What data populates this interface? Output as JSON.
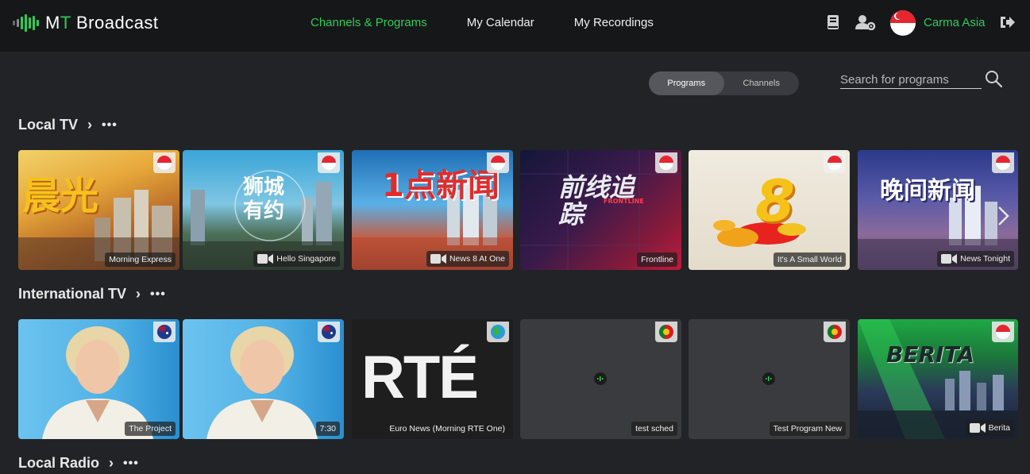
{
  "app": {
    "logo_m": "M",
    "logo_t": "T",
    "logo_rest": " Broadcast"
  },
  "nav": [
    {
      "label": "Channels & Programs",
      "active": true
    },
    {
      "label": "My Calendar",
      "active": false
    },
    {
      "label": "My Recordings",
      "active": false
    }
  ],
  "header_icons": [
    "book-icon",
    "user-settings-icon",
    "logout-icon"
  ],
  "user": {
    "name": "Carma Asia"
  },
  "toggle": {
    "programs": "Programs",
    "channels": "Channels",
    "selected": "Programs"
  },
  "search": {
    "placeholder": "Search for programs",
    "value": ""
  },
  "sections": [
    {
      "title": "Local TV",
      "cards": [
        {
          "label": "Morning Express",
          "flag": "singapore",
          "camera": false
        },
        {
          "label": "Hello Singapore",
          "flag": "singapore",
          "camera": true
        },
        {
          "label": "News 8 At One",
          "flag": "singapore",
          "camera": true
        },
        {
          "label": "Frontline",
          "flag": "singapore",
          "camera": false
        },
        {
          "label": "It's A Small World",
          "flag": "singapore",
          "camera": false
        },
        {
          "label": "News Tonight",
          "flag": "singapore",
          "camera": true
        }
      ],
      "thumb_texts": [
        "晨光",
        "狮城有约",
        "1点新闻",
        "前线追踪",
        "8",
        "晚间新闻"
      ],
      "thumb_sub_texts": [
        "FRONTLINE"
      ]
    },
    {
      "title": "International TV",
      "cards": [
        {
          "label": "The Project",
          "flag": "australia",
          "camera": false
        },
        {
          "label": "7:30",
          "flag": "australia",
          "camera": false
        },
        {
          "label": "Euro News (Morning RTE One)",
          "flag": "globe",
          "camera": false
        },
        {
          "label": "test sched",
          "flag": "portugal",
          "camera": false
        },
        {
          "label": "Test Program New",
          "flag": "portugal",
          "camera": false
        },
        {
          "label": "Berita",
          "flag": "singapore",
          "camera": true
        }
      ],
      "thumb_texts": [
        "RTÉ",
        "BERITA"
      ]
    },
    {
      "title": "Local Radio"
    }
  ],
  "colors": {
    "accent": "#2ecc55",
    "background": "#222327",
    "header": "#161719"
  }
}
